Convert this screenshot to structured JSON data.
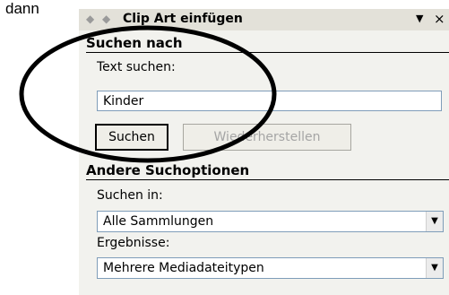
{
  "caption": "dann",
  "pane": {
    "title": "Clip Art einfügen",
    "back_glyph": "◆",
    "forward_glyph": "◆",
    "menu_glyph": "▼",
    "close_glyph": "×"
  },
  "search": {
    "section_title": "Suchen nach",
    "text_label": "Text suchen:",
    "text_value": "Kinder",
    "search_button": "Suchen",
    "restore_button": "Wiederherstellen"
  },
  "options": {
    "section_title": "Andere Suchoptionen",
    "search_in_label": "Suchen in:",
    "search_in_value": "Alle Sammlungen",
    "results_label": "Ergebnisse:",
    "results_value": "Mehrere Mediadateitypen",
    "arrow_glyph": "▼"
  }
}
